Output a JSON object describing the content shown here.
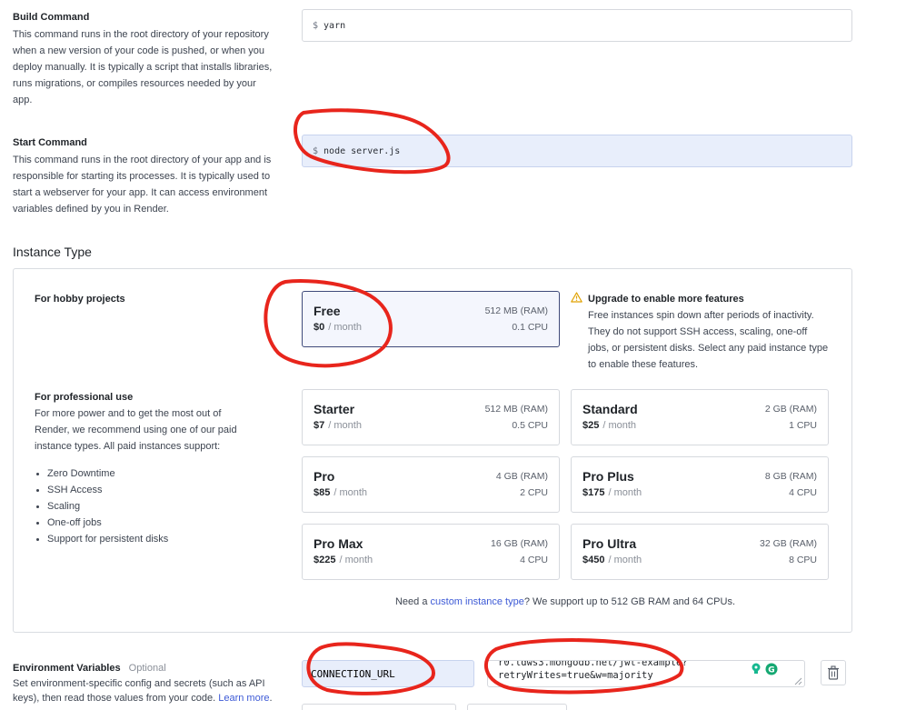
{
  "build": {
    "title": "Build Command",
    "description": "This command runs in the root directory of your repository when a new version of your code is pushed, or when you deploy manually. It is typically a script that installs libraries, runs migrations, or compiles resources needed by your app.",
    "prompt": "$",
    "value": "yarn"
  },
  "start": {
    "title": "Start Command",
    "description": "This command runs in the root directory of your app and is responsible for starting its processes. It is typically used to start a webserver for your app. It can access environment variables defined by you in Render.",
    "prompt": "$",
    "value": "node server.js"
  },
  "instance": {
    "heading": "Instance Type",
    "hobby_title": "For hobby projects",
    "professional_title": "For professional use",
    "professional_desc": "For more power and to get the most out of Render, we recommend using one of our paid instance types. All paid instances support:",
    "features": [
      "Zero Downtime",
      "SSH Access",
      "Scaling",
      "One-off jobs",
      "Support for persistent disks"
    ],
    "upgrade_title": "Upgrade to enable more features",
    "upgrade_text": "Free instances spin down after periods of inactivity. They do not support SSH access, scaling, one-off jobs, or persistent disks. Select any paid instance type to enable these features.",
    "plans": [
      {
        "name": "Free",
        "price": "$0",
        "per": "/ month",
        "ram": "512 MB (RAM)",
        "cpu": "0.1 CPU",
        "selected": true
      },
      {
        "name": "Starter",
        "price": "$7",
        "per": "/ month",
        "ram": "512 MB (RAM)",
        "cpu": "0.5 CPU"
      },
      {
        "name": "Standard",
        "price": "$25",
        "per": "/ month",
        "ram": "2 GB (RAM)",
        "cpu": "1 CPU"
      },
      {
        "name": "Pro",
        "price": "$85",
        "per": "/ month",
        "ram": "4 GB (RAM)",
        "cpu": "2 CPU"
      },
      {
        "name": "Pro Plus",
        "price": "$175",
        "per": "/ month",
        "ram": "8 GB (RAM)",
        "cpu": "4 CPU"
      },
      {
        "name": "Pro Max",
        "price": "$225",
        "per": "/ month",
        "ram": "16 GB (RAM)",
        "cpu": "4 CPU"
      },
      {
        "name": "Pro Ultra",
        "price": "$450",
        "per": "/ month",
        "ram": "32 GB (RAM)",
        "cpu": "8 CPU"
      }
    ],
    "footnote_pre": "Need a ",
    "footnote_link": "custom instance type",
    "footnote_post": "? We support up to 512 GB RAM and 64 CPUs."
  },
  "env": {
    "title": "Environment Variables",
    "optional": "Optional",
    "desc_line1": "Set environment-specific config and secrets (such as API",
    "desc_line2": "keys), then read those values from your code.",
    "learn_more": "Learn more",
    "period": ".",
    "key": "CONNECTION_URL",
    "value_line1": "r0.ldws3.mongodb.net/jwt-example?",
    "value_line2": "retryWrites=true&w=majority"
  },
  "colors": {
    "annotation": "#e8251c",
    "link": "#3d5ad6",
    "selected_border": "#3f4a7a",
    "focused_bg": "#e8eefb",
    "warning": "#e0a100"
  },
  "icons": [
    "warning-icon",
    "trash-icon",
    "grammarly-icon",
    "bulb-icon",
    "resize-handle-icon"
  ]
}
